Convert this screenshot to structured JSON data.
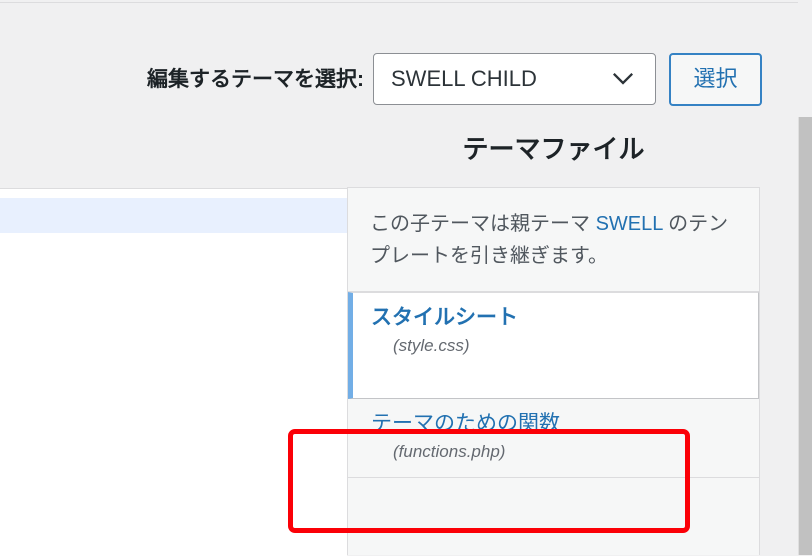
{
  "header": {
    "select_label": "編集するテーマを選択:",
    "selected_theme": "SWELL CHILD",
    "select_button_label": "選択",
    "chevron_icon": "chevron-down-icon"
  },
  "file_section": {
    "heading": "テーマファイル",
    "notice": {
      "prefix": "この子テーマは親テーマ ",
      "theme_link": "SWELL",
      "suffix": " のテンプレートを引き継ぎます。"
    },
    "items": [
      {
        "title": "スタイルシート",
        "filename": "(style.css)",
        "selected": true
      },
      {
        "title": "テーマのための関数",
        "filename": "(functions.php)",
        "selected": false
      }
    ]
  },
  "annotation": {
    "color": "#fb0007",
    "target": "テーマのための関数 (functions.php)"
  },
  "colors": {
    "page_background": "#f0f0f1",
    "panel_background": "#f6f7f7",
    "link_blue": "#2271b1",
    "accent_border": "#72aee6",
    "button_border": "#3582c4",
    "editor_active_line": "#e8f0fe",
    "scrollbar_thumb": "#c1c1c1"
  }
}
